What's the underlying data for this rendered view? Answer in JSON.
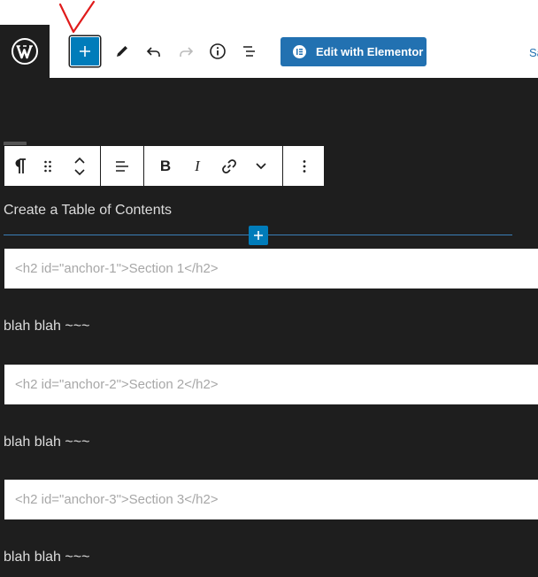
{
  "header": {
    "inserter_label": "+",
    "elementor_button_label": "Edit with Elementor",
    "save_label": "Sa",
    "annotation_mark": "V"
  },
  "block_toolbar": {
    "bold_label": "B",
    "italic_label": "I"
  },
  "content": {
    "heading_text": "Create a Table of Contents",
    "blocks": [
      {
        "html": "<h2 id=\"anchor-1\">Section 1</h2>",
        "after_text": "blah blah ~~~"
      },
      {
        "html": "<h2 id=\"anchor-2\">Section 2</h2>",
        "after_text": "blah blah ~~~"
      },
      {
        "html": "<h2 id=\"anchor-3\">Section 3</h2>",
        "after_text": "blah blah ~~~"
      }
    ]
  },
  "colors": {
    "accent": "#007cba",
    "elementor": "#2271b1",
    "canvas": "#1e1e1e",
    "annotation": "#e01b1b"
  },
  "icons": [
    "wordpress-logo-icon",
    "plus-icon",
    "pencil-icon",
    "undo-icon",
    "redo-icon",
    "info-icon",
    "list-view-icon",
    "elementor-icon",
    "paragraph-icon",
    "drag-handle-icon",
    "chevron-up-icon",
    "chevron-down-icon",
    "align-icon",
    "bold-icon",
    "italic-icon",
    "link-icon",
    "more-rich-text-icon",
    "more-options-icon"
  ]
}
